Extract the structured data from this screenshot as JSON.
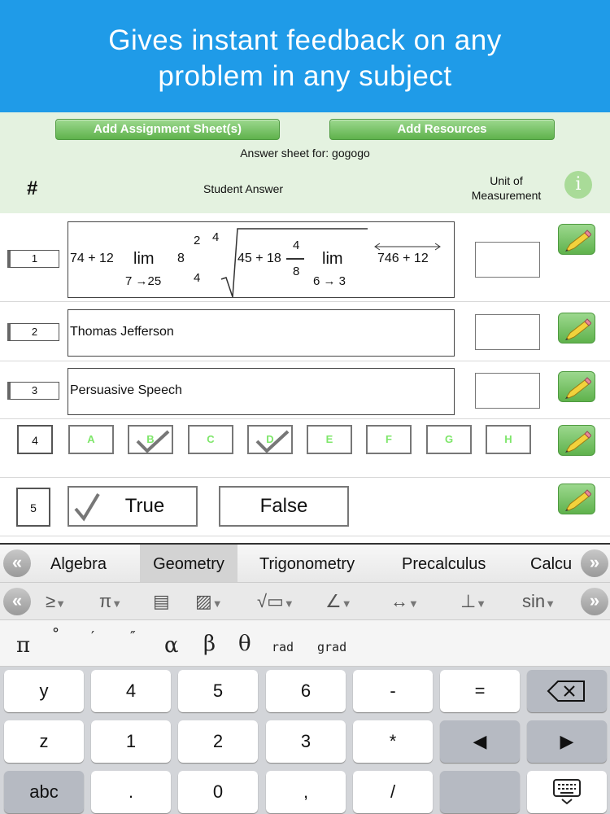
{
  "banner": {
    "line1": "Gives instant feedback on any",
    "line2": "problem in any subject"
  },
  "header": {
    "add_assignment_label": "Add Assignment Sheet(s)",
    "add_resources_label": "Add Resources",
    "answer_sheet_for": "Answer sheet for: gogogo",
    "col_number": "#",
    "col_student_answer": "Student Answer",
    "col_unit_line1": "Unit of",
    "col_unit_line2": "Measurement",
    "info_icon_label": "i"
  },
  "rows": [
    {
      "number": "1",
      "math": {
        "a": "74 + 12",
        "lim1": "lim",
        "lim1_sub": "7 →25",
        "eight": "8",
        "sup2": "2",
        "sup4": "4",
        "sub4": "4",
        "rad_expr": "45 + 18",
        "frac_num": "4",
        "frac_den": "8",
        "lim2": "lim",
        "lim2_sub": "6 → 3",
        "ray_expr": "746 + 12"
      }
    },
    {
      "number": "2",
      "answer": "Thomas Jefferson"
    },
    {
      "number": "3",
      "answer": "Persuasive Speech"
    },
    {
      "number": "4",
      "choices": [
        {
          "label": "A",
          "checked": false
        },
        {
          "label": "B",
          "checked": true
        },
        {
          "label": "C",
          "checked": false
        },
        {
          "label": "D",
          "checked": true
        },
        {
          "label": "E",
          "checked": false
        },
        {
          "label": "F",
          "checked": false
        },
        {
          "label": "G",
          "checked": false
        },
        {
          "label": "H",
          "checked": false
        }
      ]
    },
    {
      "number": "5",
      "true_label": "True",
      "false_label": "False",
      "selected": "True"
    }
  ],
  "keyboard": {
    "tabs": [
      "Algebra",
      "Geometry",
      "Trigonometry",
      "Precalculus",
      "Calcu"
    ],
    "active_tab": "Geometry",
    "symbols": [
      "≥",
      "π",
      "▤",
      "▨",
      "√▭",
      "∠",
      "↔",
      "⊥",
      "sin"
    ],
    "sub_symbols": [
      "π",
      "°",
      "′",
      "″",
      "α",
      "β",
      "θ",
      "rad",
      "grad"
    ],
    "keys": [
      [
        "y",
        "4",
        "5",
        "6",
        "-",
        "=",
        "backspace"
      ],
      [
        "z",
        "1",
        "2",
        "3",
        "*",
        "◀",
        "▶"
      ],
      [
        "abc",
        ".",
        "0",
        ",",
        "/",
        "",
        "keyboard-hide"
      ]
    ]
  },
  "colors": {
    "banner": "#1f9be8",
    "header_bg": "#e4f2e0",
    "green_button": "#6fbf5c",
    "choice_letter": "#7ee66a",
    "keyboard_bg": "#d3d5d9"
  }
}
